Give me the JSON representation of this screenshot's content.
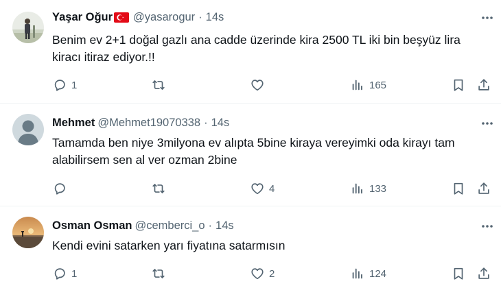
{
  "tweets": [
    {
      "name": "Yaşar Oğur",
      "handle": "@yasarogur",
      "separator": "·",
      "time": "14s",
      "text_line1": "Benim ev 2+1 doğal gazlı ana cadde üzerinde kira 2500 TL iki bin beşyüz lira",
      "text_line2": "kiracı itiraz ediyor.!!",
      "replies": "1",
      "retweets": "",
      "likes": "",
      "views": "165"
    },
    {
      "name": "Mehmet",
      "handle": "@Mehmet19070338",
      "separator": "·",
      "time": "14s",
      "text_line1": "Tamamda ben niye 3milyona ev alıpta 5bine kiraya vereyimki oda kirayı tam",
      "text_line2": "alabilirsem sen al ver ozman 2bine",
      "replies": "",
      "retweets": "",
      "likes": "4",
      "views": "133"
    },
    {
      "name": "Osman Osman",
      "handle": "@cemberci_o",
      "separator": "·",
      "time": "14s",
      "text_line1": "Kendi evini satarken yarı fiyatına satarmısın",
      "text_line2": "",
      "replies": "1",
      "retweets": "",
      "likes": "2",
      "views": "124"
    }
  ],
  "icons": {
    "reply": "reply-icon",
    "retweet": "retweet-icon",
    "like": "heart-icon",
    "views": "views-icon",
    "bookmark": "bookmark-icon",
    "share": "share-icon",
    "more": "more-icon",
    "flag": "turkey-flag-icon"
  },
  "colors": {
    "text": "#0f1419",
    "secondary": "#536471",
    "divider": "#eff3f4",
    "flag_red": "#e30a17"
  }
}
